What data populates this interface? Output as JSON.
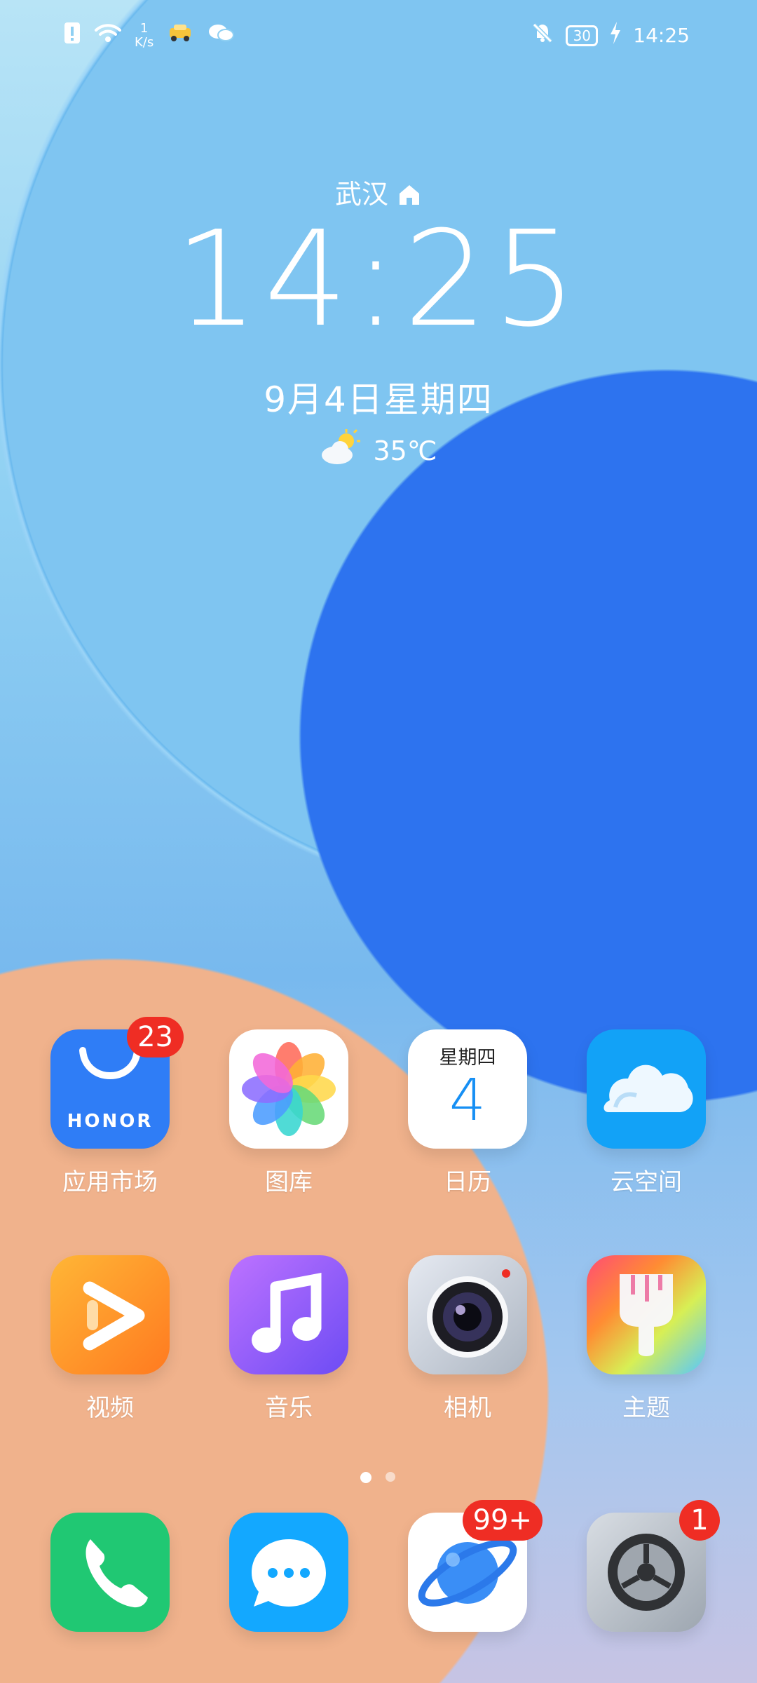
{
  "status_bar": {
    "network_speed": "1",
    "network_unit": "K/s",
    "battery": "30",
    "time": "14:25"
  },
  "lock_clock": {
    "city": "武汉",
    "time": "14:25",
    "date": "9月4日星期四",
    "temperature": "35℃"
  },
  "apps": [
    {
      "label": "应用市场",
      "badge": "23",
      "icon": "honor-store-icon",
      "wordmark": "HONOR"
    },
    {
      "label": "图库",
      "icon": "gallery-icon"
    },
    {
      "label": "日历",
      "icon": "calendar-icon",
      "weekday": "星期四",
      "day": "4"
    },
    {
      "label": "云空间",
      "icon": "cloud-icon"
    },
    {
      "label": "视频",
      "icon": "video-icon"
    },
    {
      "label": "音乐",
      "icon": "music-icon"
    },
    {
      "label": "相机",
      "icon": "camera-icon"
    },
    {
      "label": "主题",
      "icon": "theme-icon"
    }
  ],
  "dock": [
    {
      "icon": "phone-icon"
    },
    {
      "icon": "messages-icon"
    },
    {
      "icon": "browser-icon",
      "badge": "99+"
    },
    {
      "icon": "settings-icon",
      "badge": "1"
    }
  ],
  "page_indicator": {
    "pages": 2,
    "active": 1
  },
  "colors": {
    "badge_red": "#ef2d24",
    "store_blue": "#2f7df6",
    "cloud_blue": "#12a2f7",
    "phone_green": "#20c873",
    "messages_blue": "#13a8ff"
  }
}
